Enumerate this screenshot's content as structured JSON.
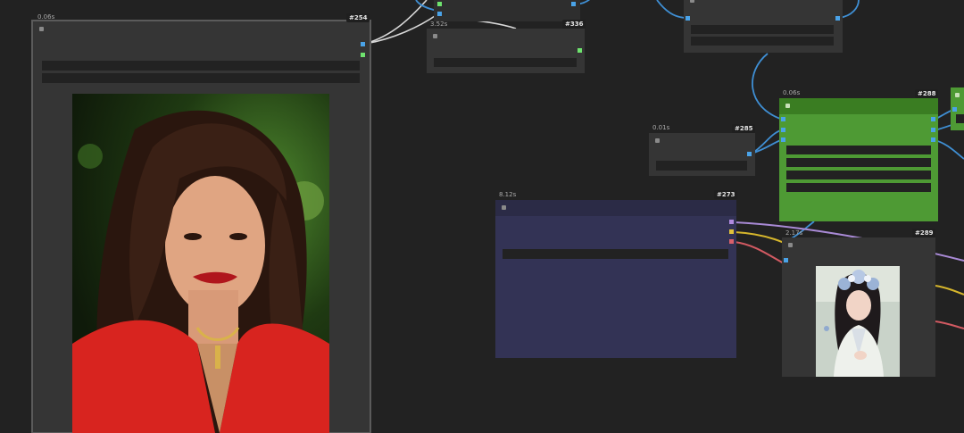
{
  "nodes": {
    "n254": {
      "id": "#254",
      "time": "0.06s"
    },
    "n336": {
      "id": "#336",
      "time": "3.52s"
    },
    "n285": {
      "id": "#285",
      "time": "0.01s"
    },
    "n288": {
      "id": "#288",
      "time": "0.06s"
    },
    "n273": {
      "id": "#273",
      "time": "8.12s"
    },
    "n289": {
      "id": "#289",
      "time": "2.17s"
    }
  },
  "colors": {
    "canvas": "#222222",
    "node_body": "#353535",
    "green_node": "#4e9a34",
    "purple_node": "#333355",
    "wire_blue": "#3f8fd4",
    "wire_white": "#d8d8d8",
    "wire_lilac": "#a98ad6",
    "wire_yellow": "#d6b62c",
    "wire_red": "#d25a62"
  },
  "images": {
    "large_preview": "portrait-photo-woman-red-jacket",
    "small_preview": "portrait-photo-woman-floral-headdress"
  }
}
